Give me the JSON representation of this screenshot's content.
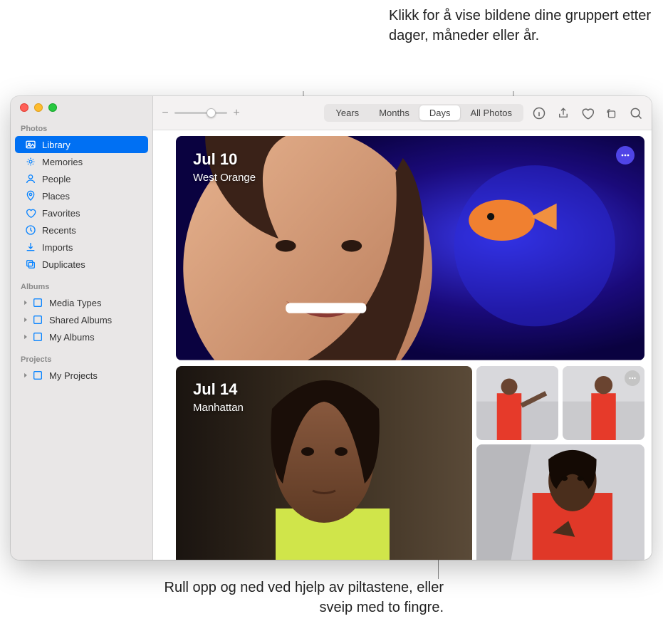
{
  "callouts": {
    "top": "Klikk for å vise bildene dine gruppert etter dager, måneder eller år.",
    "bottom": "Rull opp og ned ved hjelp av piltastene, eller sveip med to fingre."
  },
  "sidebar": {
    "sections": {
      "photos": "Photos",
      "albums": "Albums",
      "projects": "Projects"
    },
    "items": {
      "library": "Library",
      "memories": "Memories",
      "people": "People",
      "places": "Places",
      "favorites": "Favorites",
      "recents": "Recents",
      "imports": "Imports",
      "duplicates": "Duplicates",
      "media_types": "Media Types",
      "shared_albums": "Shared Albums",
      "my_albums": "My Albums",
      "my_projects": "My Projects"
    }
  },
  "toolbar": {
    "segments": {
      "years": "Years",
      "months": "Months",
      "days": "Days",
      "all_photos": "All Photos"
    }
  },
  "content": {
    "day1": {
      "date": "Jul 10",
      "location": "West Orange"
    },
    "day2": {
      "date": "Jul 14",
      "location": "Manhattan"
    }
  },
  "icons": {
    "minus": "−",
    "plus": "+"
  }
}
